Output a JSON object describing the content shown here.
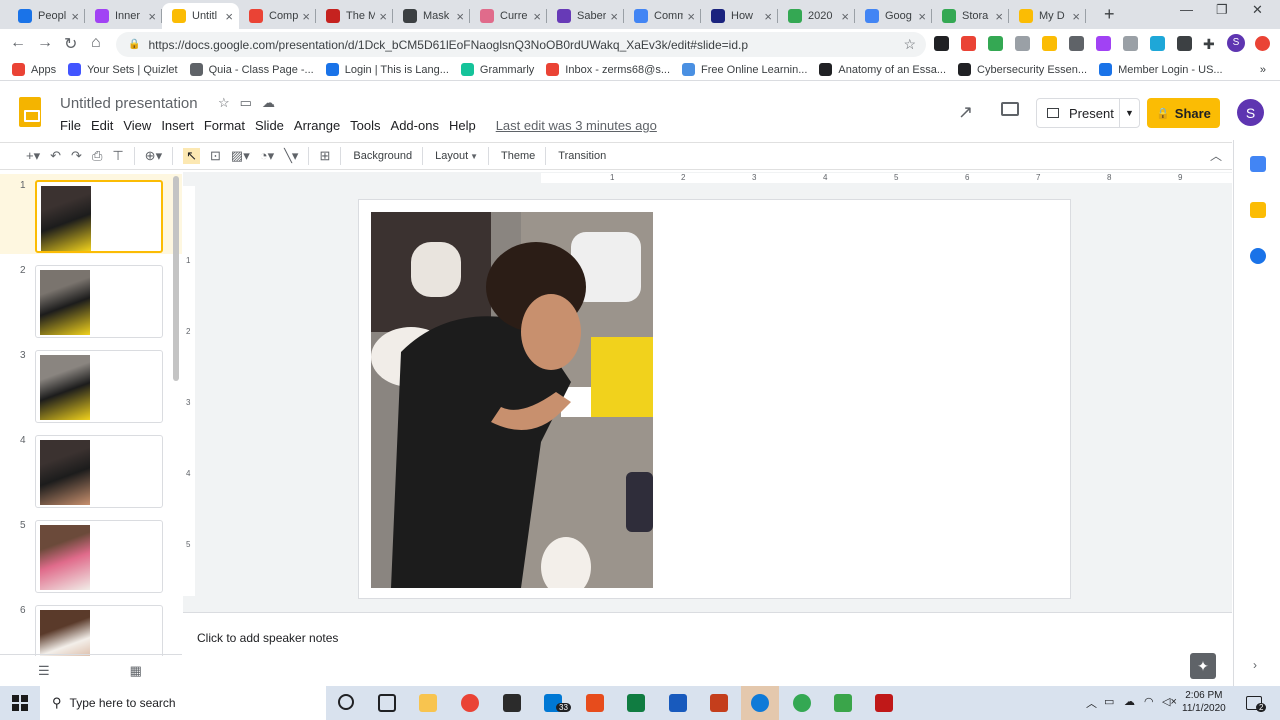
{
  "browser": {
    "tabs": [
      {
        "label": "Peopl",
        "color": "#1a73e8"
      },
      {
        "label": "Inner",
        "color": "#a142f4"
      },
      {
        "label": "Untitl",
        "color": "#fbbc04",
        "active": true
      },
      {
        "label": "Comp",
        "color": "#ea4335"
      },
      {
        "label": "The M",
        "color": "#c5221f"
      },
      {
        "label": "Mask",
        "color": "#3c4043"
      },
      {
        "label": "Curre",
        "color": "#e06b8b"
      },
      {
        "label": "Saber",
        "color": "#673ab7"
      },
      {
        "label": "Comm",
        "color": "#4285f4"
      },
      {
        "label": "How",
        "color": "#1a237e"
      },
      {
        "label": "2020",
        "color": "#34a853"
      },
      {
        "label": "Goog",
        "color": "#4285f4"
      },
      {
        "label": "Stora",
        "color": "#34a853"
      },
      {
        "label": "My D",
        "color": "#fbbc04"
      }
    ],
    "new_tab": "+",
    "url": "https://docs.google.com/presentation/d/1Dck_bCM5D61lEoFNaoglsnQ3NoOB0rdUWakq_XaEv3k/edit#slide=id.p",
    "bookmarks": [
      {
        "label": "Apps",
        "color": "#ea4335"
      },
      {
        "label": "Your Sets | Quizlet",
        "color": "#4255ff"
      },
      {
        "label": "Quia - Class Page -...",
        "color": "#5f6368"
      },
      {
        "label": "Login | This is Lang...",
        "color": "#1a73e8"
      },
      {
        "label": "Grammarly",
        "color": "#15c39a"
      },
      {
        "label": "Inbox - zerms68@s...",
        "color": "#ea4335"
      },
      {
        "label": "Free Online Learnin...",
        "color": "#4a90e2"
      },
      {
        "label": "Anatomy of an Essa...",
        "color": "#202124"
      },
      {
        "label": "Cybersecurity Essen...",
        "color": "#202124"
      },
      {
        "label": "Member Login - US...",
        "color": "#1a73e8"
      }
    ],
    "bookmark_overflow": "»",
    "profile_initial": "S"
  },
  "slides_app": {
    "title": "Untitled presentation",
    "menu": [
      "File",
      "Edit",
      "View",
      "Insert",
      "Format",
      "Slide",
      "Arrange",
      "Tools",
      "Add-ons",
      "Help"
    ],
    "last_edit": "Last edit was 3 minutes ago",
    "present_label": "Present",
    "share_label": "Share",
    "user_initial": "S",
    "toolbar": {
      "background": "Background",
      "layout": "Layout",
      "theme": "Theme",
      "transition": "Transition"
    },
    "slide_numbers": [
      "1",
      "2",
      "3",
      "4",
      "5",
      "6"
    ],
    "ruler_h": [
      "1",
      "2",
      "3",
      "4",
      "5",
      "6",
      "7",
      "8",
      "9"
    ],
    "ruler_v": [
      "1",
      "2",
      "3",
      "4",
      "5"
    ],
    "speaker_notes_placeholder": "Click to add speaker notes"
  },
  "taskbar": {
    "search_placeholder": "Type here to search",
    "mail_badge": "33",
    "time": "2:06 PM",
    "date": "11/1/2020",
    "notification_count": "2"
  },
  "colors": {
    "accent": "#fbbc04",
    "avatar": "#5e35b1"
  }
}
